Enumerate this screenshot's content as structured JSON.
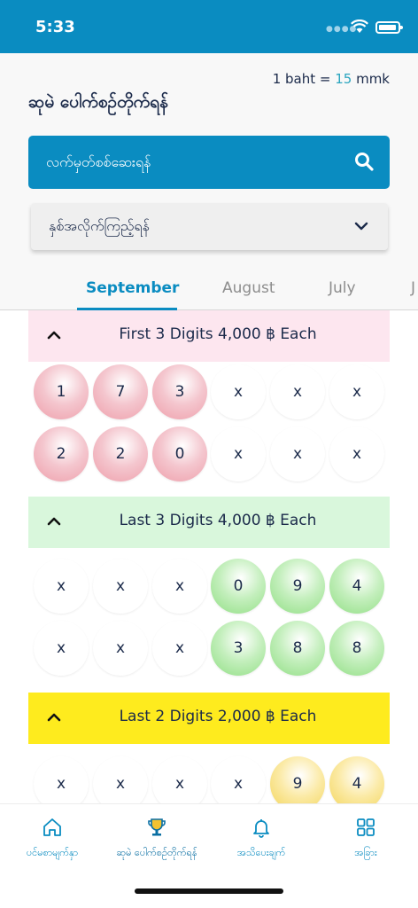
{
  "status": {
    "time": "5:33",
    "dots": "●●●●"
  },
  "header": {
    "rate_prefix": "1 baht = ",
    "rate_value": "15",
    "rate_suffix": " mmk",
    "title": "ဆုမဲ ပေါက်စဉ်တိုက်ရန်"
  },
  "search": {
    "label": "လက်မှတ်စစ်ဆေးရန်"
  },
  "year_select": {
    "label": "နှစ်အလိုက်ကြည့်ရန်"
  },
  "tabs": [
    {
      "label": "September",
      "active": true
    },
    {
      "label": "August",
      "active": false
    },
    {
      "label": "July",
      "active": false
    },
    {
      "label": "J",
      "active": false
    }
  ],
  "sections": {
    "first3": {
      "title": "First 3 Digits 4,000 ฿ Each",
      "rows": [
        [
          "1",
          "7",
          "3",
          "x",
          "x",
          "x"
        ],
        [
          "2",
          "2",
          "0",
          "x",
          "x",
          "x"
        ]
      ]
    },
    "last3": {
      "title": "Last 3 Digits 4,000 ฿ Each",
      "rows": [
        [
          "x",
          "x",
          "x",
          "0",
          "9",
          "4"
        ],
        [
          "x",
          "x",
          "x",
          "3",
          "8",
          "8"
        ]
      ]
    },
    "last2": {
      "title": "Last 2 Digits 2,000 ฿ Each",
      "rows": [
        [
          "x",
          "x",
          "x",
          "x",
          "9",
          "4"
        ]
      ]
    }
  },
  "bottom_nav": [
    {
      "label": "ပင်မစာမျက်နှာ",
      "icon": "home-icon"
    },
    {
      "label": "ဆုမဲ ပေါက်စဉ်တိုက်ရန်",
      "icon": "trophy-icon"
    },
    {
      "label": "အသိပေးချက်",
      "icon": "bell-icon"
    },
    {
      "label": "အခြား",
      "icon": "grid-icon"
    }
  ],
  "colors": {
    "primary": "#0a8cc1",
    "first_bg": "#fde6ef",
    "last3_bg": "#d9f7dc",
    "last2_bg": "#feeb1e"
  }
}
